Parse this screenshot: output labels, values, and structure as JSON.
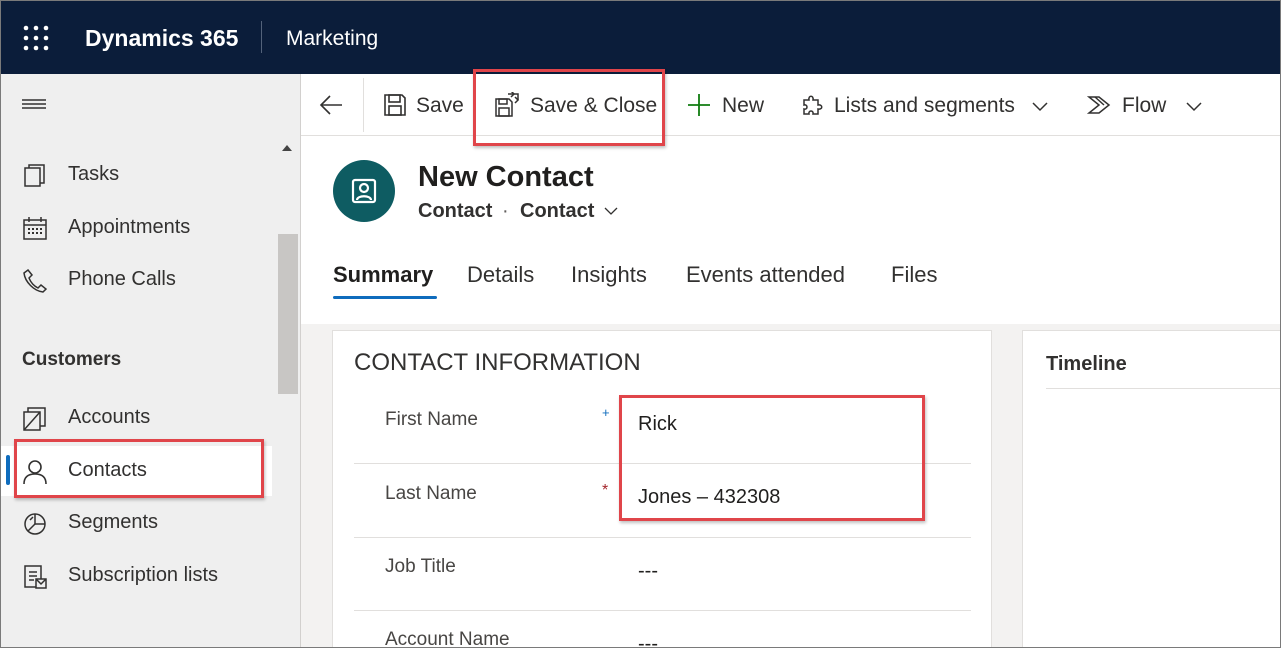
{
  "header": {
    "app_title": "Dynamics 365",
    "module": "Marketing"
  },
  "sidebar": {
    "items": [
      {
        "label": "Tasks",
        "icon": "tasks-icon"
      },
      {
        "label": "Appointments",
        "icon": "calendar-icon"
      },
      {
        "label": "Phone Calls",
        "icon": "phone-icon"
      }
    ],
    "section_customers": "Customers",
    "customer_items": [
      {
        "label": "Accounts",
        "icon": "accounts-icon"
      },
      {
        "label": "Contacts",
        "icon": "contact-person-icon",
        "selected": true
      },
      {
        "label": "Segments",
        "icon": "segments-icon"
      },
      {
        "label": "Subscription lists",
        "icon": "subscription-list-icon"
      }
    ]
  },
  "commands": {
    "save": "Save",
    "save_close": "Save & Close",
    "new": "New",
    "lists_segments": "Lists and segments",
    "flow": "Flow"
  },
  "record": {
    "title": "New Contact",
    "entity": "Contact",
    "separator": "·",
    "form": "Contact"
  },
  "tabs": [
    {
      "label": "Summary",
      "active": true
    },
    {
      "label": "Details"
    },
    {
      "label": "Insights"
    },
    {
      "label": "Events attended"
    },
    {
      "label": "Files"
    }
  ],
  "section": {
    "title": "CONTACT INFORMATION",
    "fields": [
      {
        "label": "First Name",
        "value": "Rick",
        "required_marker": "+",
        "required": "recommended"
      },
      {
        "label": "Last Name",
        "value": "Jones – 432308",
        "required_marker": "*",
        "required": "required"
      },
      {
        "label": "Job Title",
        "value": "---"
      },
      {
        "label": "Account Name",
        "value": "---"
      }
    ]
  },
  "timeline": {
    "title": "Timeline"
  },
  "colors": {
    "topbar": "#0b1d3a",
    "accent": "#0f6cbd",
    "avatar": "#0e5c62",
    "callout": "#e0454a",
    "required": "#a4262c"
  }
}
